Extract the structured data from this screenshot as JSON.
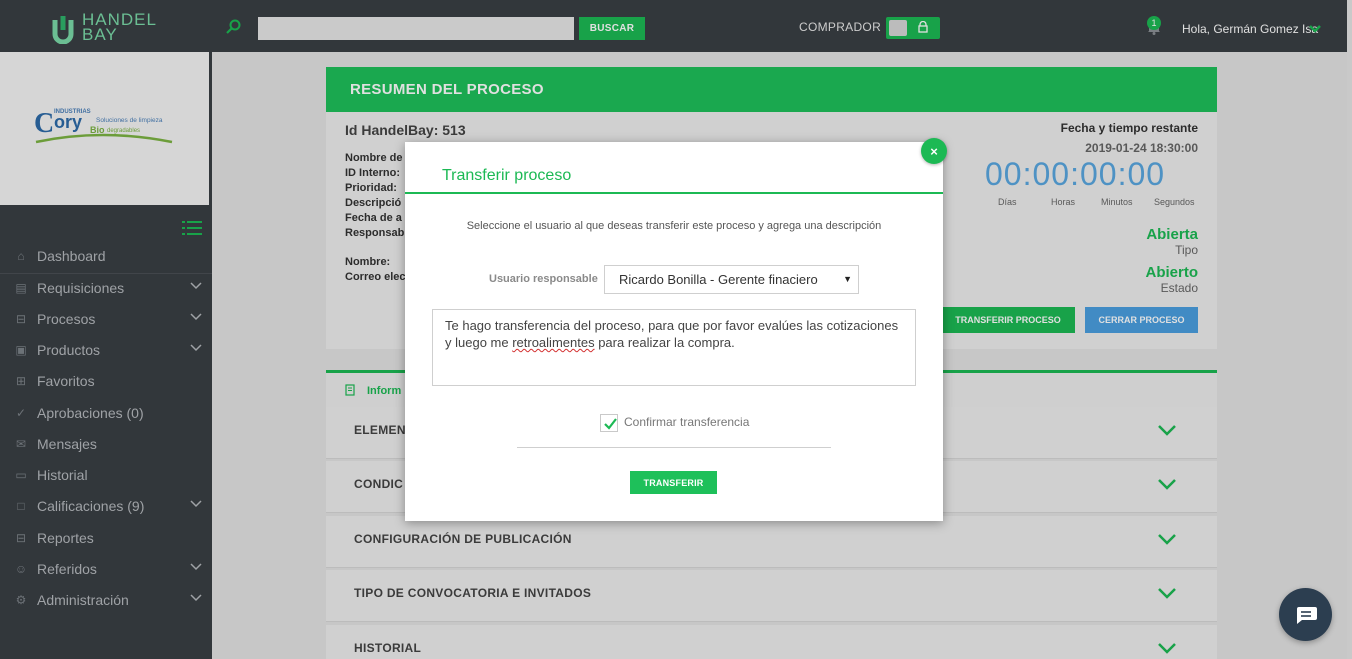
{
  "app": {
    "brand": "HANDEL BAY",
    "brand_line1": "HANDEL",
    "brand_line2": "BAY",
    "client_logo": "Cory Industrias - Soluciones de limpieza Bio degradables",
    "colors": {
      "accent": "#1cb954",
      "topbar": "#3a3f44",
      "timer": "#59a7e0",
      "secondary_button": "#4a9fe0"
    }
  },
  "topbar": {
    "search_placeholder": "",
    "search_button": "BUSCAR",
    "mode_label": "COMPRADOR",
    "notification_count": "1",
    "greeting": "Hola, Germán Gomez Isa"
  },
  "sidebar": {
    "items": [
      {
        "label": "Dashboard",
        "icon": "home-icon",
        "has_submenu": false
      },
      {
        "label": "Requisiciones",
        "icon": "clipboard-icon",
        "has_submenu": true
      },
      {
        "label": "Procesos",
        "icon": "basket-icon",
        "has_submenu": true
      },
      {
        "label": "Productos",
        "icon": "briefcase-icon",
        "has_submenu": true
      },
      {
        "label": "Favoritos",
        "icon": "store-icon",
        "has_submenu": false
      },
      {
        "label": "Aprobaciones (0)",
        "icon": "check-icon",
        "has_submenu": false
      },
      {
        "label": "Mensajes",
        "icon": "inbox-icon",
        "has_submenu": false
      },
      {
        "label": "Historial",
        "icon": "folder-icon",
        "has_submenu": false
      },
      {
        "label": "Calificaciones (9)",
        "icon": "square-icon",
        "has_submenu": true
      },
      {
        "label": "Reportes",
        "icon": "basket-icon",
        "has_submenu": false
      },
      {
        "label": "Referidos",
        "icon": "users-icon",
        "has_submenu": true
      },
      {
        "label": "Administración",
        "icon": "gear-icon",
        "has_submenu": true
      }
    ]
  },
  "process": {
    "header": "RESUMEN DEL PROCESO",
    "id_label": "Id HandelBay: 513",
    "fields": [
      "Nombre de",
      "ID Interno:",
      "Prioridad:",
      "Descripció",
      "Fecha de a",
      "Responsab",
      "Nombre:",
      "Correo elec"
    ],
    "fecha_title": "Fecha y tiempo restante",
    "fecha_value": "2019-01-24 18:30:00",
    "timer": "00:00:00:00",
    "timer_units": [
      "Días",
      "Horas",
      "Minutos",
      "Segundos"
    ],
    "status_value": "Abierta",
    "status_label": "Tipo",
    "state_value": "Abierto",
    "state_label": "Estado",
    "btn_transfer": "TRANSFERIR PROCESO",
    "btn_close": "CERRAR PROCESO",
    "tab_label": "Inform",
    "accordion": [
      "ELEMEN",
      "CONDIC",
      "CONFIGURACIÓN DE PUBLICACIÓN",
      "TIPO DE CONVOCATORIA E INVITADOS",
      "HISTORIAL"
    ]
  },
  "modal": {
    "title": "Transferir proceso",
    "close_symbol": "×",
    "description": "Seleccione el usuario al que deseas transferir este proceso y agrega una descripción",
    "responsible_label": "Usuario responsable",
    "responsible_value": "Ricardo Bonilla - Gerente finaciero",
    "message_part1": "Te hago transferencia del proceso, para que por favor evalúes las cotizaciones y luego me ",
    "message_misspelled": "retroalimentes",
    "message_part2": " para realizar la compra.",
    "confirm_label": "Confirmar transferencia",
    "confirm_checked": true,
    "submit_button": "TRANSFERIR"
  }
}
